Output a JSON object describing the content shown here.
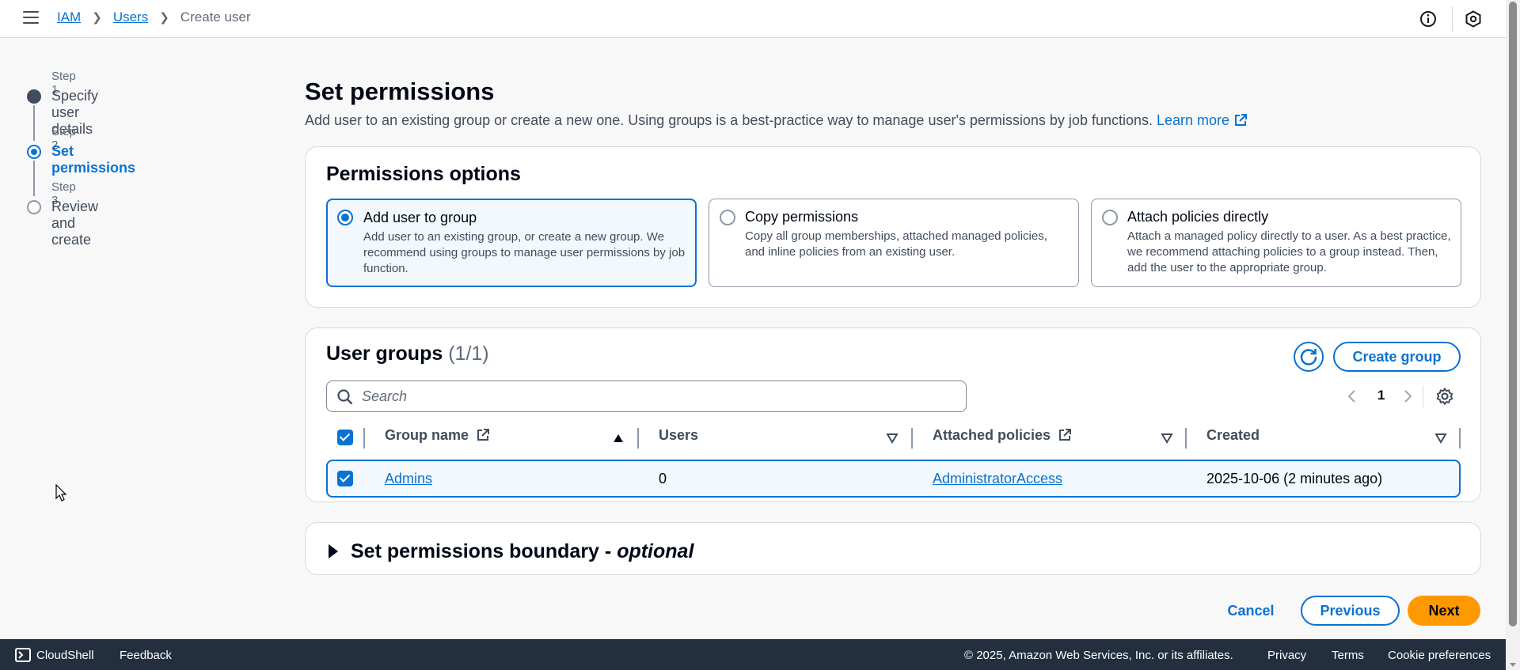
{
  "topbar": {
    "breadcrumbs": [
      "IAM",
      "Users",
      "Create user"
    ]
  },
  "steps": [
    {
      "label": "Step 1",
      "title": "Specify user details",
      "state": "complete"
    },
    {
      "label": "Step 2",
      "title": "Set permissions",
      "state": "active"
    },
    {
      "label": "Step 3",
      "title": "Review and create",
      "state": "pending"
    }
  ],
  "main": {
    "title": "Set permissions",
    "description": "Add user to an existing group or create a new one. Using groups is a best-practice way to manage user's permissions by job functions.",
    "learn_more": "Learn more"
  },
  "permissions_options": {
    "title": "Permissions options",
    "options": [
      {
        "title": "Add user to group",
        "desc": "Add user to an existing group, or create a new group. We recommend using groups to manage user permissions by job function.",
        "selected": true
      },
      {
        "title": "Copy permissions",
        "desc": "Copy all group memberships, attached managed policies, and inline policies from an existing user.",
        "selected": false
      },
      {
        "title": "Attach policies directly",
        "desc": "Attach a managed policy directly to a user. As a best practice, we recommend attaching policies to a group instead. Then, add the user to the appropriate group.",
        "selected": false
      }
    ]
  },
  "user_groups": {
    "title": "User groups",
    "count": "(1/1)",
    "create_label": "Create group",
    "search_placeholder": "Search",
    "page": "1",
    "columns": [
      "Group name",
      "Users",
      "Attached policies",
      "Created"
    ],
    "rows": [
      {
        "name": "Admins",
        "users": "0",
        "policies": "AdministratorAccess",
        "created": "2025-10-06 (2 minutes ago)"
      }
    ]
  },
  "boundary": {
    "title": "Set permissions boundary - ",
    "optional": "optional"
  },
  "actions": {
    "cancel": "Cancel",
    "previous": "Previous",
    "next": "Next"
  },
  "footer": {
    "cloudshell": "CloudShell",
    "feedback": "Feedback",
    "copyright": "© 2025, Amazon Web Services, Inc. or its affiliates.",
    "privacy": "Privacy",
    "terms": "Terms",
    "cookies": "Cookie preferences"
  },
  "colors": {
    "accent": "#0972d3",
    "primary_button": "#ff9900",
    "footer_bg": "#232f3e"
  }
}
